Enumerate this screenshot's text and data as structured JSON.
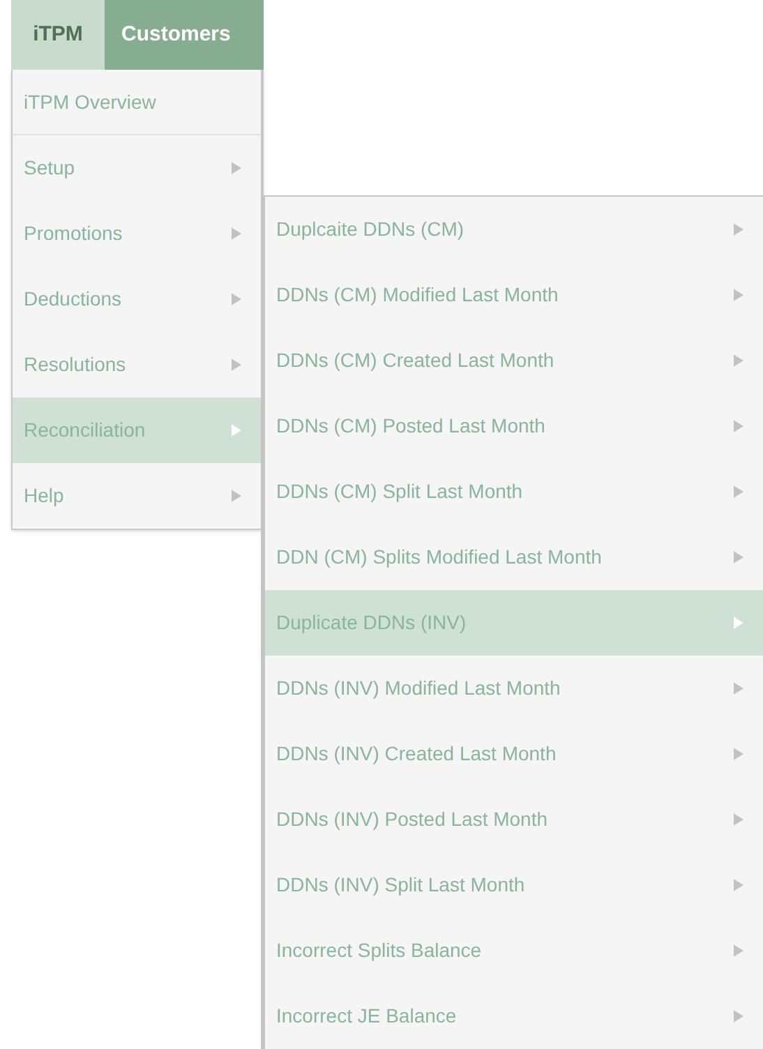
{
  "tabs": [
    {
      "label": "iTPM",
      "selected": false
    },
    {
      "label": "Customers",
      "selected": true
    }
  ],
  "menu": {
    "items": [
      {
        "label": "iTPM Overview",
        "has_submenu": false,
        "selected": false
      },
      {
        "label": "Setup",
        "has_submenu": true,
        "selected": false
      },
      {
        "label": "Promotions",
        "has_submenu": true,
        "selected": false
      },
      {
        "label": "Deductions",
        "has_submenu": true,
        "selected": false
      },
      {
        "label": "Resolutions",
        "has_submenu": true,
        "selected": false
      },
      {
        "label": "Reconciliation",
        "has_submenu": true,
        "selected": true
      },
      {
        "label": "Help",
        "has_submenu": true,
        "selected": false
      }
    ]
  },
  "submenu": {
    "items": [
      {
        "label": "Duplcaite DDNs (CM)",
        "has_submenu": true,
        "selected": false
      },
      {
        "label": "DDNs (CM) Modified Last Month",
        "has_submenu": true,
        "selected": false
      },
      {
        "label": "DDNs (CM) Created Last Month",
        "has_submenu": true,
        "selected": false
      },
      {
        "label": "DDNs (CM) Posted Last Month",
        "has_submenu": true,
        "selected": false
      },
      {
        "label": "DDNs (CM) Split Last Month",
        "has_submenu": true,
        "selected": false
      },
      {
        "label": "DDN (CM) Splits Modified Last Month",
        "has_submenu": true,
        "selected": false
      },
      {
        "label": "Duplicate DDNs (INV)",
        "has_submenu": true,
        "selected": true
      },
      {
        "label": "DDNs (INV) Modified Last Month",
        "has_submenu": true,
        "selected": false
      },
      {
        "label": "DDNs (INV) Created Last Month",
        "has_submenu": true,
        "selected": false
      },
      {
        "label": "DDNs (INV) Posted Last Month",
        "has_submenu": true,
        "selected": false
      },
      {
        "label": "DDNs (INV) Split Last Month",
        "has_submenu": true,
        "selected": false
      },
      {
        "label": "Incorrect Splits Balance",
        "has_submenu": true,
        "selected": false
      },
      {
        "label": "Incorrect JE Balance",
        "has_submenu": true,
        "selected": false
      }
    ]
  }
}
